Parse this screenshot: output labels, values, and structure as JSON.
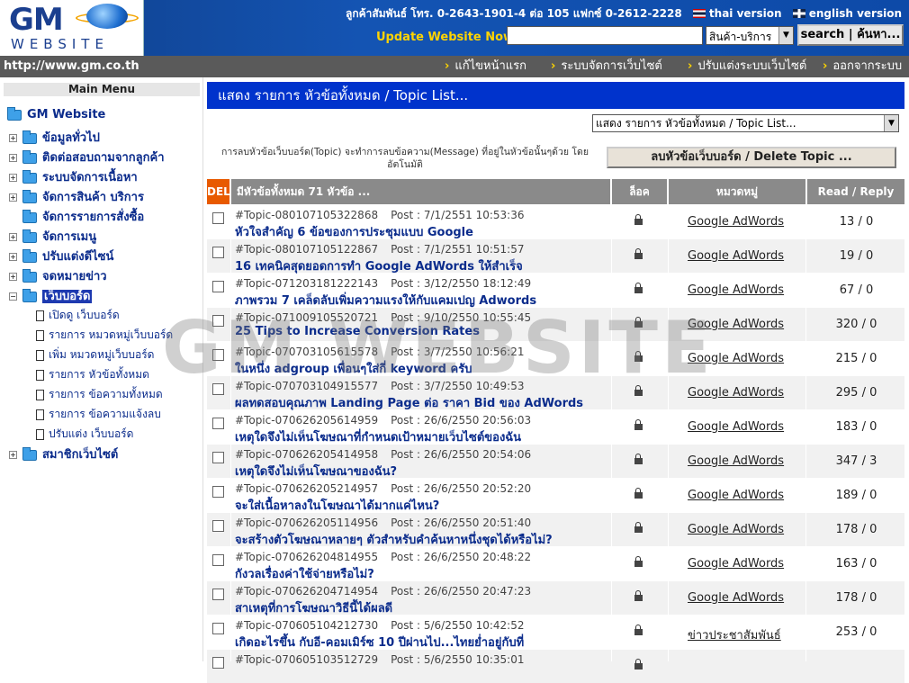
{
  "header": {
    "logo_gm": "GM",
    "logo_website": "WEBSITE",
    "contact": "ลูกค้าสัมพันธ์ โทร. 0-2643-1901-4 ต่อ 105 แฟกซ์ 0-2612-2228",
    "lang_th": "thai version",
    "lang_en": "english version",
    "update_label": "Update Website Now!",
    "search_value": "",
    "category_selected": "สินค้า-บริการ",
    "search_button": "search | ค้นหา..."
  },
  "navbar": {
    "url": "http://www.gm.co.th",
    "links": [
      "แก้ไขหน้าแรก",
      "ระบบจัดการเว็บไซต์",
      "ปรับแต่งระบบเว็บไซต์",
      "ออกจากระบบ"
    ]
  },
  "sidebar": {
    "title": "Main Menu",
    "root": "GM Website",
    "items": [
      "ข้อมูลทั่วไป",
      "ติดต่อสอบถามจากลูกค้า",
      "ระบบจัดการเนื้อหา",
      "จัดการสินค้า บริการ",
      "จัดการรายการสั่งซื้อ",
      "จัดการเมนู",
      "ปรับแต่งดีไซน์",
      "จดหมายข่าว",
      "เว็บบอร์ด"
    ],
    "subitems": [
      "เปิดดู เว็บบอร์ด",
      "รายการ หมวดหมู่เว็บบอร์ด",
      "เพิ่ม หมวดหมู่เว็บบอร์ด",
      "รายการ หัวข้อทั้งหมด",
      "รายการ ข้อความทั้งหมด",
      "รายการ ข้อความแจ้งลบ",
      "ปรับแต่ง เว็บบอร์ด"
    ],
    "last": "สมาชิกเว็บไซต์"
  },
  "main": {
    "title": "แสดง รายการ หัวข้อทั้งหมด / Topic List...",
    "select_value": "แสดง รายการ หัวข้อทั้งหมด / Topic List...",
    "delete_note": "การลบหัวข้อเว็บบอร์ด(Topic) จะทำการลบข้อความ(Message) ที่อยู่ในหัวข้อนั้นๆด้วย โดยอัตโนมัติ",
    "delete_button": "ลบหัวข้อเว็บบอร์ด / Delete Topic ...",
    "columns": {
      "del": "DEL",
      "topic": "มีหัวข้อทั้งหมด 71 หัวข้อ ...",
      "lock": "ล็อค",
      "category": "หมวดหมู่",
      "read": "Read / Reply"
    },
    "rows": [
      {
        "id": "#Topic-080107105322868",
        "post": "Post : 7/1/2551 10:53:36",
        "title": "หัวใจสำคัญ 6 ข้อของการประชุมแบบ Google",
        "category": "Google AdWords",
        "rr": "13 / 0"
      },
      {
        "id": "#Topic-080107105122867",
        "post": "Post : 7/1/2551 10:51:57",
        "title": "16 เทคนิคสุดยอดการทำ Google AdWords ให้สำเร็จ",
        "category": "Google AdWords",
        "rr": "19 / 0"
      },
      {
        "id": "#Topic-071203181222143",
        "post": "Post : 3/12/2550 18:12:49",
        "title": "ภาพรวม 7 เคล็ดลับเพิ่มความแรงให้กับแคมเปญ Adwords",
        "category": "Google AdWords",
        "rr": "67 / 0"
      },
      {
        "id": "#Topic-071009105520721",
        "post": "Post : 9/10/2550 10:55:45",
        "title": "25 Tips to Increase Conversion Rates",
        "category": "Google AdWords",
        "rr": "320 / 0"
      },
      {
        "id": "#Topic-070703105615578",
        "post": "Post : 3/7/2550 10:56:21",
        "title": "ในหนึ่ง adgroup เพื่อนๆใส่กี่ keyword ครับ",
        "category": "Google AdWords",
        "rr": "215 / 0"
      },
      {
        "id": "#Topic-070703104915577",
        "post": "Post : 3/7/2550 10:49:53",
        "title": "ผลทดสอบคุณภาพ Landing Page ต่อ ราคา Bid ของ AdWords",
        "category": "Google AdWords",
        "rr": "295 / 0"
      },
      {
        "id": "#Topic-070626205614959",
        "post": "Post : 26/6/2550 20:56:03",
        "title": "เหตุใดจึงไม่เห็นโฆษณาที่กำหนดเป้าหมายเว็บไซต์ของฉัน",
        "category": "Google AdWords",
        "rr": "183 / 0"
      },
      {
        "id": "#Topic-070626205414958",
        "post": "Post : 26/6/2550 20:54:06",
        "title": "เหตุใดจึงไม่เห็นโฆษณาของฉัน?",
        "category": "Google AdWords",
        "rr": "347 / 3"
      },
      {
        "id": "#Topic-070626205214957",
        "post": "Post : 26/6/2550 20:52:20",
        "title": "จะใส่เนื้อหาลงในโฆษณาได้มากแค่ไหน?",
        "category": "Google AdWords",
        "rr": "189 / 0"
      },
      {
        "id": "#Topic-070626205114956",
        "post": "Post : 26/6/2550 20:51:40",
        "title": "จะสร้างตัวโฆษณาหลายๆ ตัวสำหรับคำค้นหาหนึ่งชุดได้หรือไม่?",
        "category": "Google AdWords",
        "rr": "178 / 0"
      },
      {
        "id": "#Topic-070626204814955",
        "post": "Post : 26/6/2550 20:48:22",
        "title": "กังวลเรื่องค่าใช้จ่ายหรือไม่?",
        "category": "Google AdWords",
        "rr": "163 / 0"
      },
      {
        "id": "#Topic-070626204714954",
        "post": "Post : 26/6/2550 20:47:23",
        "title": "สาเหตุที่การโฆษณาวิธีนี้ได้ผลดี",
        "category": "Google AdWords",
        "rr": "178 / 0"
      },
      {
        "id": "#Topic-070605104212730",
        "post": "Post : 5/6/2550 10:42:52",
        "title": "เกิดอะไรขึ้น กับอี-คอมเมิร์ซ 10 ปีผ่านไป...ไทยย่ำอยู่กับที่",
        "category": "ข่าวประชาสัมพันธ์",
        "rr": "253 / 0"
      },
      {
        "id": "#Topic-070605103512729",
        "post": "Post : 5/6/2550 10:35:01",
        "title": "",
        "category": "",
        "rr": ""
      }
    ]
  },
  "watermark": "GM WEBSITE"
}
